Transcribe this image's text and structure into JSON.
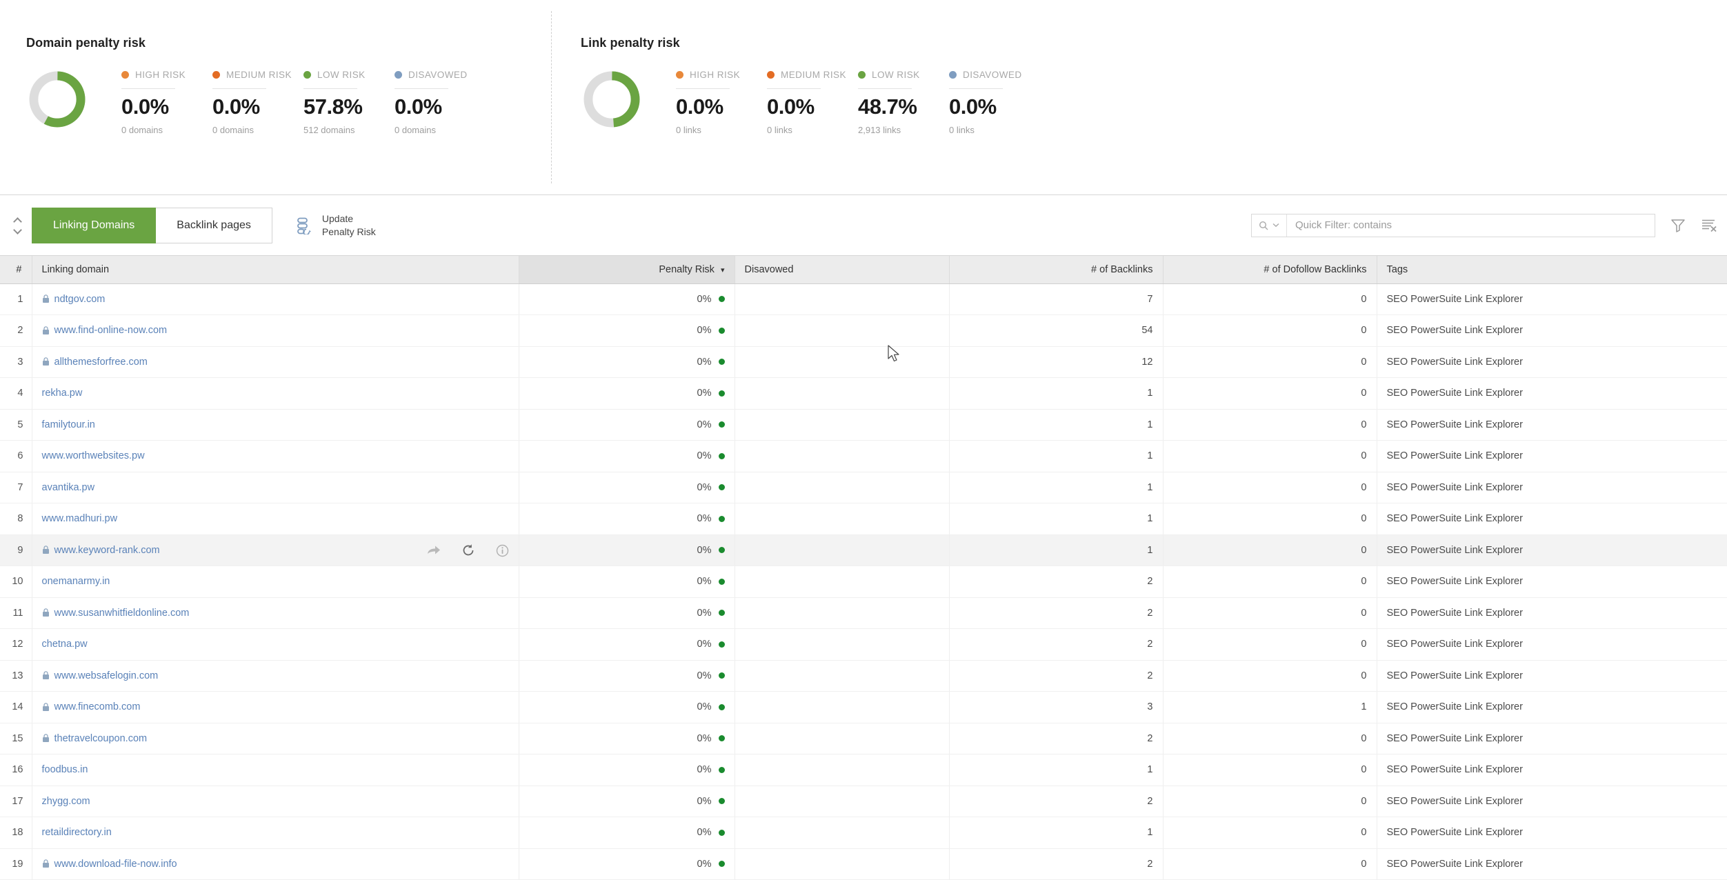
{
  "panels": [
    {
      "title": "Domain penalty risk",
      "donut": {
        "filled_pct": 57.8,
        "fill_color": "#6aa442",
        "track_color": "#dddddd"
      },
      "legend": [
        {
          "label": "HIGH RISK",
          "color": "#e8883a",
          "value": "0.0%",
          "sub": "0 domains"
        },
        {
          "label": "MEDIUM RISK",
          "color": "#e36c24",
          "value": "0.0%",
          "sub": "0 domains"
        },
        {
          "label": "LOW RISK",
          "color": "#6aa442",
          "value": "57.8%",
          "sub": "512 domains"
        },
        {
          "label": "DISAVOWED",
          "color": "#7f9dc0",
          "value": "0.0%",
          "sub": "0 domains"
        }
      ]
    },
    {
      "title": "Link penalty risk",
      "donut": {
        "filled_pct": 48.7,
        "fill_color": "#6aa442",
        "track_color": "#dddddd"
      },
      "legend": [
        {
          "label": "HIGH RISK",
          "color": "#e8883a",
          "value": "0.0%",
          "sub": "0 links"
        },
        {
          "label": "MEDIUM RISK",
          "color": "#e36c24",
          "value": "0.0%",
          "sub": "0 links"
        },
        {
          "label": "LOW RISK",
          "color": "#6aa442",
          "value": "48.7%",
          "sub": "2,913 links"
        },
        {
          "label": "DISAVOWED",
          "color": "#7f9dc0",
          "value": "0.0%",
          "sub": "0 links"
        }
      ]
    }
  ],
  "toolbar": {
    "tabs": [
      {
        "label": "Linking Domains",
        "active": true
      },
      {
        "label": "Backlink pages",
        "active": false
      }
    ],
    "update_button": {
      "line1": "Update",
      "line2": "Penalty Risk",
      "icon": "refresh-links-icon"
    },
    "search_placeholder": "Quick Filter: contains",
    "search_value": "",
    "icons": [
      "search-icon",
      "chevron-down-icon",
      "filter-icon",
      "clear-filter-icon"
    ]
  },
  "table": {
    "columns": [
      {
        "key": "idx",
        "label": "#",
        "align": "right",
        "sorted": false
      },
      {
        "key": "dom",
        "label": "Linking domain",
        "align": "left",
        "sorted": false
      },
      {
        "key": "risk",
        "label": "Penalty Risk",
        "align": "right",
        "sorted": true,
        "sort_dir": "desc"
      },
      {
        "key": "dis",
        "label": "Disavowed",
        "align": "left",
        "sorted": false
      },
      {
        "key": "bl",
        "label": "# of Backlinks",
        "align": "right",
        "sorted": false
      },
      {
        "key": "dfbl",
        "label": "# of Dofollow Backlinks",
        "align": "right",
        "sorted": false
      },
      {
        "key": "tags",
        "label": "Tags",
        "align": "left",
        "sorted": false
      }
    ],
    "hover_row_index": 9,
    "row_action_icons": [
      "share-icon",
      "refresh-icon",
      "info-icon"
    ],
    "rows": [
      {
        "idx": "1",
        "domain": "ndtgov.com",
        "locked": true,
        "risk": "0%",
        "disavowed": "",
        "backlinks": "7",
        "dofollow": "0",
        "tags": "SEO PowerSuite Link Explorer"
      },
      {
        "idx": "2",
        "domain": "www.find-online-now.com",
        "locked": true,
        "risk": "0%",
        "disavowed": "",
        "backlinks": "54",
        "dofollow": "0",
        "tags": "SEO PowerSuite Link Explorer"
      },
      {
        "idx": "3",
        "domain": "allthemesforfree.com",
        "locked": true,
        "risk": "0%",
        "disavowed": "",
        "backlinks": "12",
        "dofollow": "0",
        "tags": "SEO PowerSuite Link Explorer"
      },
      {
        "idx": "4",
        "domain": "rekha.pw",
        "locked": false,
        "risk": "0%",
        "disavowed": "",
        "backlinks": "1",
        "dofollow": "0",
        "tags": "SEO PowerSuite Link Explorer"
      },
      {
        "idx": "5",
        "domain": "familytour.in",
        "locked": false,
        "risk": "0%",
        "disavowed": "",
        "backlinks": "1",
        "dofollow": "0",
        "tags": "SEO PowerSuite Link Explorer"
      },
      {
        "idx": "6",
        "domain": "www.worthwebsites.pw",
        "locked": false,
        "risk": "0%",
        "disavowed": "",
        "backlinks": "1",
        "dofollow": "0",
        "tags": "SEO PowerSuite Link Explorer"
      },
      {
        "idx": "7",
        "domain": "avantika.pw",
        "locked": false,
        "risk": "0%",
        "disavowed": "",
        "backlinks": "1",
        "dofollow": "0",
        "tags": "SEO PowerSuite Link Explorer"
      },
      {
        "idx": "8",
        "domain": "www.madhuri.pw",
        "locked": false,
        "risk": "0%",
        "disavowed": "",
        "backlinks": "1",
        "dofollow": "0",
        "tags": "SEO PowerSuite Link Explorer"
      },
      {
        "idx": "9",
        "domain": "www.keyword-rank.com",
        "locked": true,
        "risk": "0%",
        "disavowed": "",
        "backlinks": "1",
        "dofollow": "0",
        "tags": "SEO PowerSuite Link Explorer"
      },
      {
        "idx": "10",
        "domain": "onemanarmy.in",
        "locked": false,
        "risk": "0%",
        "disavowed": "",
        "backlinks": "2",
        "dofollow": "0",
        "tags": "SEO PowerSuite Link Explorer"
      },
      {
        "idx": "11",
        "domain": "www.susanwhitfieldonline.com",
        "locked": true,
        "risk": "0%",
        "disavowed": "",
        "backlinks": "2",
        "dofollow": "0",
        "tags": "SEO PowerSuite Link Explorer"
      },
      {
        "idx": "12",
        "domain": "chetna.pw",
        "locked": false,
        "risk": "0%",
        "disavowed": "",
        "backlinks": "2",
        "dofollow": "0",
        "tags": "SEO PowerSuite Link Explorer"
      },
      {
        "idx": "13",
        "domain": "www.websafelogin.com",
        "locked": true,
        "risk": "0%",
        "disavowed": "",
        "backlinks": "2",
        "dofollow": "0",
        "tags": "SEO PowerSuite Link Explorer"
      },
      {
        "idx": "14",
        "domain": "www.finecomb.com",
        "locked": true,
        "risk": "0%",
        "disavowed": "",
        "backlinks": "3",
        "dofollow": "1",
        "tags": "SEO PowerSuite Link Explorer"
      },
      {
        "idx": "15",
        "domain": "thetravelcoupon.com",
        "locked": true,
        "risk": "0%",
        "disavowed": "",
        "backlinks": "2",
        "dofollow": "0",
        "tags": "SEO PowerSuite Link Explorer"
      },
      {
        "idx": "16",
        "domain": "foodbus.in",
        "locked": false,
        "risk": "0%",
        "disavowed": "",
        "backlinks": "1",
        "dofollow": "0",
        "tags": "SEO PowerSuite Link Explorer"
      },
      {
        "idx": "17",
        "domain": "zhygg.com",
        "locked": false,
        "risk": "0%",
        "disavowed": "",
        "backlinks": "2",
        "dofollow": "0",
        "tags": "SEO PowerSuite Link Explorer"
      },
      {
        "idx": "18",
        "domain": "retaildirectory.in",
        "locked": false,
        "risk": "0%",
        "disavowed": "",
        "backlinks": "1",
        "dofollow": "0",
        "tags": "SEO PowerSuite Link Explorer"
      },
      {
        "idx": "19",
        "domain": "www.download-file-now.info",
        "locked": true,
        "risk": "0%",
        "disavowed": "",
        "backlinks": "2",
        "dofollow": "0",
        "tags": "SEO PowerSuite Link Explorer"
      }
    ]
  },
  "colors": {
    "accent_green": "#6aa442",
    "risk_dot_green": "#1a8b2e",
    "link_blue": "#5a82b8"
  }
}
